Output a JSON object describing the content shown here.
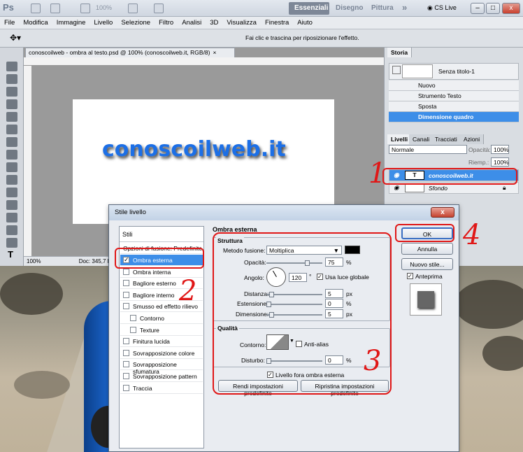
{
  "titlebar": {
    "logo": "Ps",
    "zoom": "100%",
    "workspaces": [
      "Essenziali",
      "Disegno",
      "Pittura"
    ],
    "more": "»",
    "cslive": "CS Live"
  },
  "menu": [
    "File",
    "Modifica",
    "Immagine",
    "Livello",
    "Selezione",
    "Filtro",
    "Analisi",
    "3D",
    "Visualizza",
    "Finestra",
    "Aiuto"
  ],
  "options_bar": {
    "hint": "Fai clic e trascina per riposizionare l'effetto."
  },
  "document": {
    "tab_title": "conoscoilweb - ombra al testo.psd @ 100% (conoscoilweb.it, RGB/8)",
    "tab_close": "×",
    "canvas_text": "conoscoilweb.it",
    "status_zoom": "100%",
    "status_doc": "Doc: 345,7 KB"
  },
  "history": {
    "tab": "Storia",
    "snapshot": "Senza titolo-1",
    "items": [
      "Nuovo",
      "Strumento Testo",
      "Sposta",
      "Dimensione quadro"
    ]
  },
  "layers_panel": {
    "tabs": [
      "Livelli",
      "Canali",
      "Tracciati",
      "Azioni"
    ],
    "blend": "Normale",
    "opacity_label": "Opacità:",
    "opacity": "100%",
    "fill_label": "Riemp.:",
    "fill": "100%",
    "layers": [
      {
        "name": "conoscoilweb.it",
        "thumb": "T"
      },
      {
        "name": "Sfondo",
        "thumb": ""
      }
    ]
  },
  "dialog": {
    "title": "Stile livello",
    "close": "x",
    "list_header": "Stili",
    "blend_options": "Opzioni di fusione: Predefinite",
    "styles": [
      {
        "label": "Ombra esterna",
        "checked": true,
        "indent": false
      },
      {
        "label": "Ombra interna",
        "checked": false,
        "indent": false
      },
      {
        "label": "Bagliore esterno",
        "checked": false,
        "indent": false
      },
      {
        "label": "Bagliore interno",
        "checked": false,
        "indent": false
      },
      {
        "label": "Smusso ed effetto rilievo",
        "checked": false,
        "indent": false
      },
      {
        "label": "Contorno",
        "checked": false,
        "indent": true
      },
      {
        "label": "Texture",
        "checked": false,
        "indent": true
      },
      {
        "label": "Finitura lucida",
        "checked": false,
        "indent": false
      },
      {
        "label": "Sovrapposizione colore",
        "checked": false,
        "indent": false
      },
      {
        "label": "Sovrapposizione sfumatura",
        "checked": false,
        "indent": false
      },
      {
        "label": "Sovrapposizione pattern",
        "checked": false,
        "indent": false
      },
      {
        "label": "Traccia",
        "checked": false,
        "indent": false
      }
    ],
    "section_title": "Ombra esterna",
    "structure": {
      "title": "Struttura",
      "blend_label": "Metodo fusione:",
      "blend_value": "Moltiplica",
      "shadow_color": "#000000",
      "opacity_label": "Opacità:",
      "opacity_value": "75",
      "opacity_unit": "%",
      "angle_label": "Angolo:",
      "angle_value": "120",
      "angle_unit": "°",
      "global_light_label": "Usa luce globale",
      "distance_label": "Distanza:",
      "distance_value": "5",
      "distance_unit": "px",
      "spread_label": "Estensione:",
      "spread_value": "0",
      "spread_unit": "%",
      "size_label": "Dimensione:",
      "size_value": "5",
      "size_unit": "px"
    },
    "quality": {
      "title": "Qualità",
      "contour_label": "Contorno:",
      "antialias_label": "Anti-alias",
      "noise_label": "Disturbo:",
      "noise_value": "0",
      "noise_unit": "%"
    },
    "knockout_label": "Livello fora ombra esterna",
    "make_default": "Rendi impostazioni predefinite",
    "reset_default": "Ripristina impostazioni predefinite",
    "ok": "OK",
    "cancel": "Annulla",
    "new_style": "Nuovo stile...",
    "preview": "Anteprima"
  },
  "annotations": [
    "1",
    "2",
    "3",
    "4"
  ]
}
